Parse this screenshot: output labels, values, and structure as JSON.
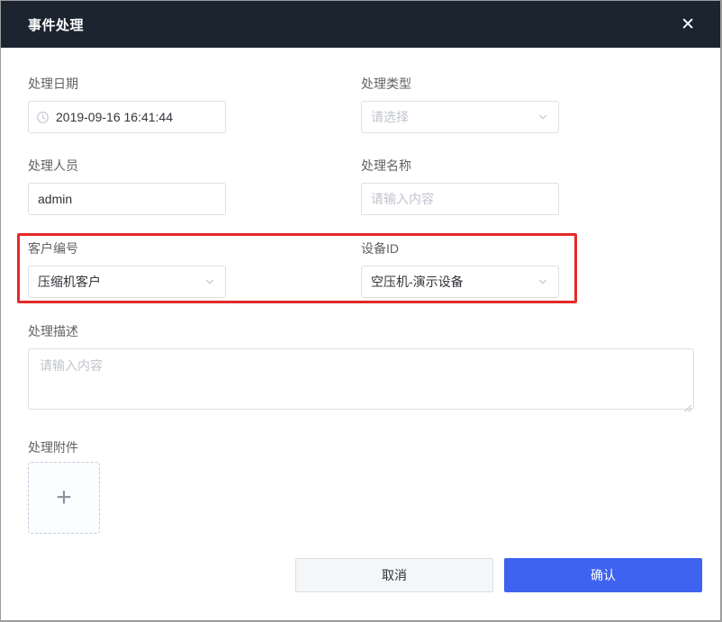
{
  "modal": {
    "title": "事件处理",
    "close_glyph": "✕"
  },
  "form": {
    "date": {
      "label": "处理日期",
      "value": "2019-09-16 16:41:44"
    },
    "type": {
      "label": "处理类型",
      "placeholder": "请选择"
    },
    "person": {
      "label": "处理人员",
      "value": "admin"
    },
    "name": {
      "label": "处理名称",
      "placeholder": "请输入内容"
    },
    "customer": {
      "label": "客户编号",
      "value": "压缩机客户"
    },
    "device": {
      "label": "设备ID",
      "value": "空压机-演示设备"
    },
    "description": {
      "label": "处理描述",
      "placeholder": "请输入内容"
    },
    "attachment": {
      "label": "处理附件",
      "plus_glyph": "+"
    }
  },
  "footer": {
    "cancel_label": "取消",
    "confirm_label": "确认"
  },
  "icons": {
    "clock": "clock-icon",
    "chevron": "chevron-down-icon"
  },
  "colors": {
    "header_bg": "#1c2430",
    "accent_blue": "#3e63f0",
    "highlight_red": "#e32a2a",
    "border_gray": "#dcdfe6",
    "placeholder_gray": "#c0c4cc"
  }
}
